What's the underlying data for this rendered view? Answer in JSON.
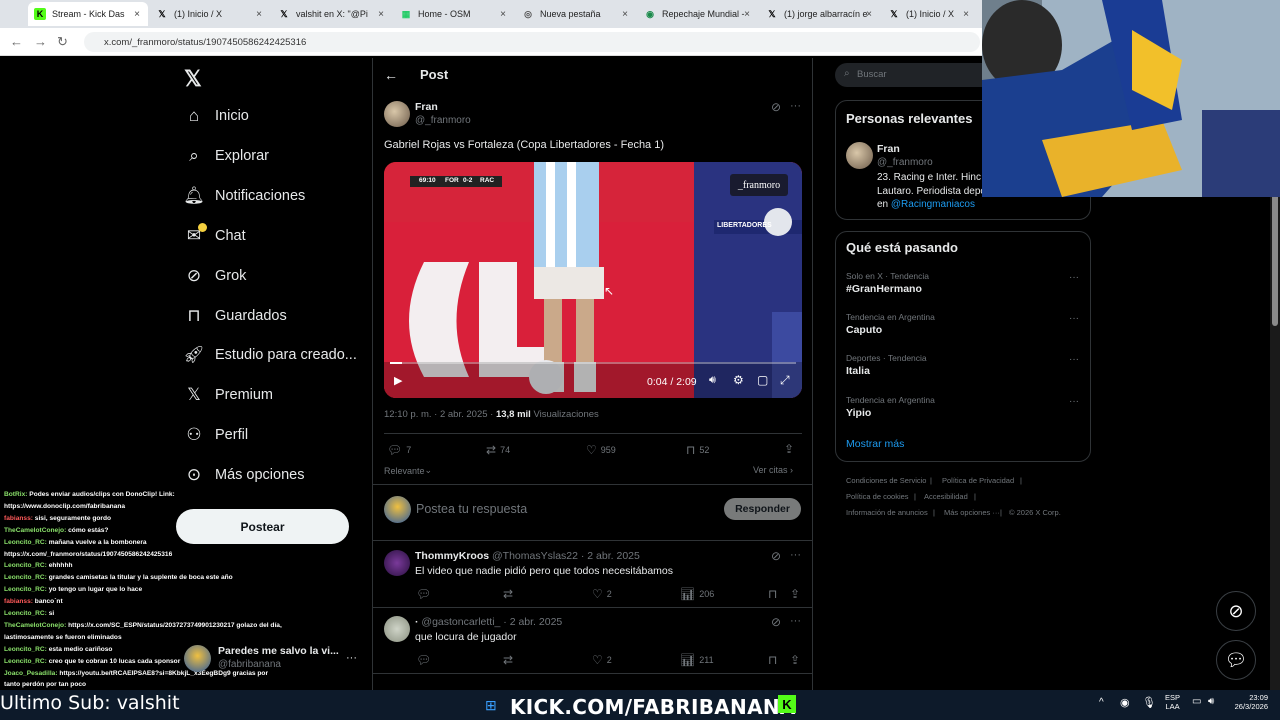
{
  "browser": {
    "tabs": [
      {
        "label": "Stream - Kick Das",
        "icon": "kick-icon",
        "active": true
      },
      {
        "label": "(1) Inicio / X",
        "icon": "x-icon"
      },
      {
        "label": "valshit en X: \"@Pi",
        "icon": "x-icon"
      },
      {
        "label": "Home - OSM",
        "icon": "osm-icon"
      },
      {
        "label": "Nueva pestaña",
        "icon": "globe-icon"
      },
      {
        "label": "Repechaje Mundial -",
        "icon": "site-icon"
      },
      {
        "label": "(1) jorge albarracín e",
        "icon": "x-icon"
      },
      {
        "label": "(1) Inicio / X",
        "icon": "x-icon"
      }
    ],
    "url": "x.com/_franmoro/status/1907450586242425316"
  },
  "sidebar": {
    "items": [
      {
        "label": "Inicio",
        "icon": "home-icon"
      },
      {
        "label": "Explorar",
        "icon": "search-icon"
      },
      {
        "label": "Notificaciones",
        "icon": "bell-icon"
      },
      {
        "label": "Chat",
        "icon": "mail-icon"
      },
      {
        "label": "Grok",
        "icon": "grok-icon"
      },
      {
        "label": "Guardados",
        "icon": "bookmark-icon"
      },
      {
        "label": "Estudio para creado...",
        "icon": "rocket-icon"
      },
      {
        "label": "Premium",
        "icon": "x-icon"
      },
      {
        "label": "Perfil",
        "icon": "person-icon"
      },
      {
        "label": "Más opciones",
        "icon": "more-circle-icon"
      }
    ],
    "post_button": "Postear",
    "account": {
      "name": "Paredes me salvo la vi...",
      "handle": "@fabribanana"
    }
  },
  "main": {
    "title": "Post",
    "post": {
      "author": "Fran",
      "handle": "@_franmoro",
      "text": "Gabriel Rojas vs Fortaleza (Copa Libertadores - Fecha 1)",
      "video": {
        "watermark": "_franmoro",
        "scoreboard_time": "69:10",
        "scoreboard_home": "FOR",
        "scoreboard_score": "0-2",
        "scoreboard_away": "RAC",
        "banner_text": "LIBERTADORES",
        "time": "0:04 / 2:09",
        "progress": 0.03
      },
      "time": "12:10 p. m. · 2 abr. 2025 ·",
      "views_count": "13,8 mil",
      "views_label": "Visualizaciones",
      "replies": "7",
      "reposts": "74",
      "likes": "959",
      "bookmarks": "52",
      "sort": "Relevante",
      "quotes": "Ver citas"
    },
    "reply_placeholder": "Postea tu respuesta",
    "reply_button": "Responder",
    "replies": [
      {
        "name": "ThommyKroos",
        "handle": "@ThomasYslas22 · 2 abr. 2025",
        "text": "El video que nadie pidió pero que todos necesitábamos",
        "likes": "2",
        "views": "206"
      },
      {
        "name": "·",
        "handle": "@gastoncarletti_ · 2 abr. 2025",
        "text": "que locura de jugador",
        "likes": "2",
        "views": "211"
      }
    ]
  },
  "right": {
    "search_placeholder": "Buscar",
    "relevant_title": "Personas relevantes",
    "relevant_person": {
      "name": "Fran",
      "handle": "@_franmoro",
      "bio1": "23. Racing e Inter. Hinc",
      "bio2": "Lautaro. Periodista depo",
      "bio3_prefix": "en ",
      "bio3_link": "@Racingmaniacos"
    },
    "trends_title": "Qué está pasando",
    "trends": [
      {
        "meta": "Solo en X · Tendencia",
        "name": "#GranHermano"
      },
      {
        "meta": "Tendencia en Argentina",
        "name": "Caputo"
      },
      {
        "meta": "Deportes · Tendencia",
        "name": "Italia"
      },
      {
        "meta": "Tendencia en Argentina",
        "name": "Yipio"
      }
    ],
    "show_more": "Mostrar más",
    "footer": [
      "Condiciones de Servicio",
      "Política de Privacidad",
      "Política de cookies",
      "Accesibilidad",
      "Información de anuncios",
      "Más opciones ···",
      "© 2026 X Corp."
    ]
  },
  "stream_overlay": {
    "chat": [
      {
        "user": "BotRix:",
        "msg": "Podes enviar audios/clips con DonoClip! Link:"
      },
      {
        "user": "",
        "msg": "https://www.donoclip.com/fabribanana"
      },
      {
        "user": "fabianss:",
        "msg": "sisi, seguramente gordo",
        "red": true
      },
      {
        "user": "TheCamelotConejo:",
        "msg": "cómo estás?"
      },
      {
        "user": "Leoncito_RC:",
        "msg": "mañana vuelve a la bombonera"
      },
      {
        "user": "",
        "msg": "https://x.com/_franmoro/status/1907450586242425316"
      },
      {
        "user": "Leoncito_RC:",
        "msg": "ehhhhh"
      },
      {
        "user": "Leoncito_RC:",
        "msg": "grandes camisetas la titular y la suplente de boca este año"
      },
      {
        "user": "Leoncito_RC:",
        "msg": "yo tengo un lugar que lo hace"
      },
      {
        "user": "fabianss:",
        "msg": "banco´nt",
        "red": true
      },
      {
        "user": "Leoncito_RC:",
        "msg": "si"
      },
      {
        "user": "TheCamelotConejo:",
        "msg": "https://x.com/SC_ESPN/status/2037273749901230217 golazo del día,"
      },
      {
        "user": "",
        "msg": "lastimosamente se fueron eliminados"
      },
      {
        "user": "Leoncito_RC:",
        "msg": "esta medio cariñoso"
      },
      {
        "user": "Leoncito_RC:",
        "msg": "creo que te cobran 10 lucas cada sponsor"
      },
      {
        "user": "Joaco_Pesadilla:",
        "msg": "https://youtu.be/tRCAEIPSAE8?si=8KbkjL_x3EegBDg9 gracias por"
      },
      {
        "user": "",
        "msg": "tanto perdón por tan poco"
      }
    ],
    "last_sub": "Ultimo Sub: valshit",
    "kick_banner": "KICK.COM/FABRIBANANA"
  },
  "taskbar": {
    "lang": "ESP",
    "layout": "LAA",
    "time": "23:09",
    "date": "26/3/2026"
  }
}
